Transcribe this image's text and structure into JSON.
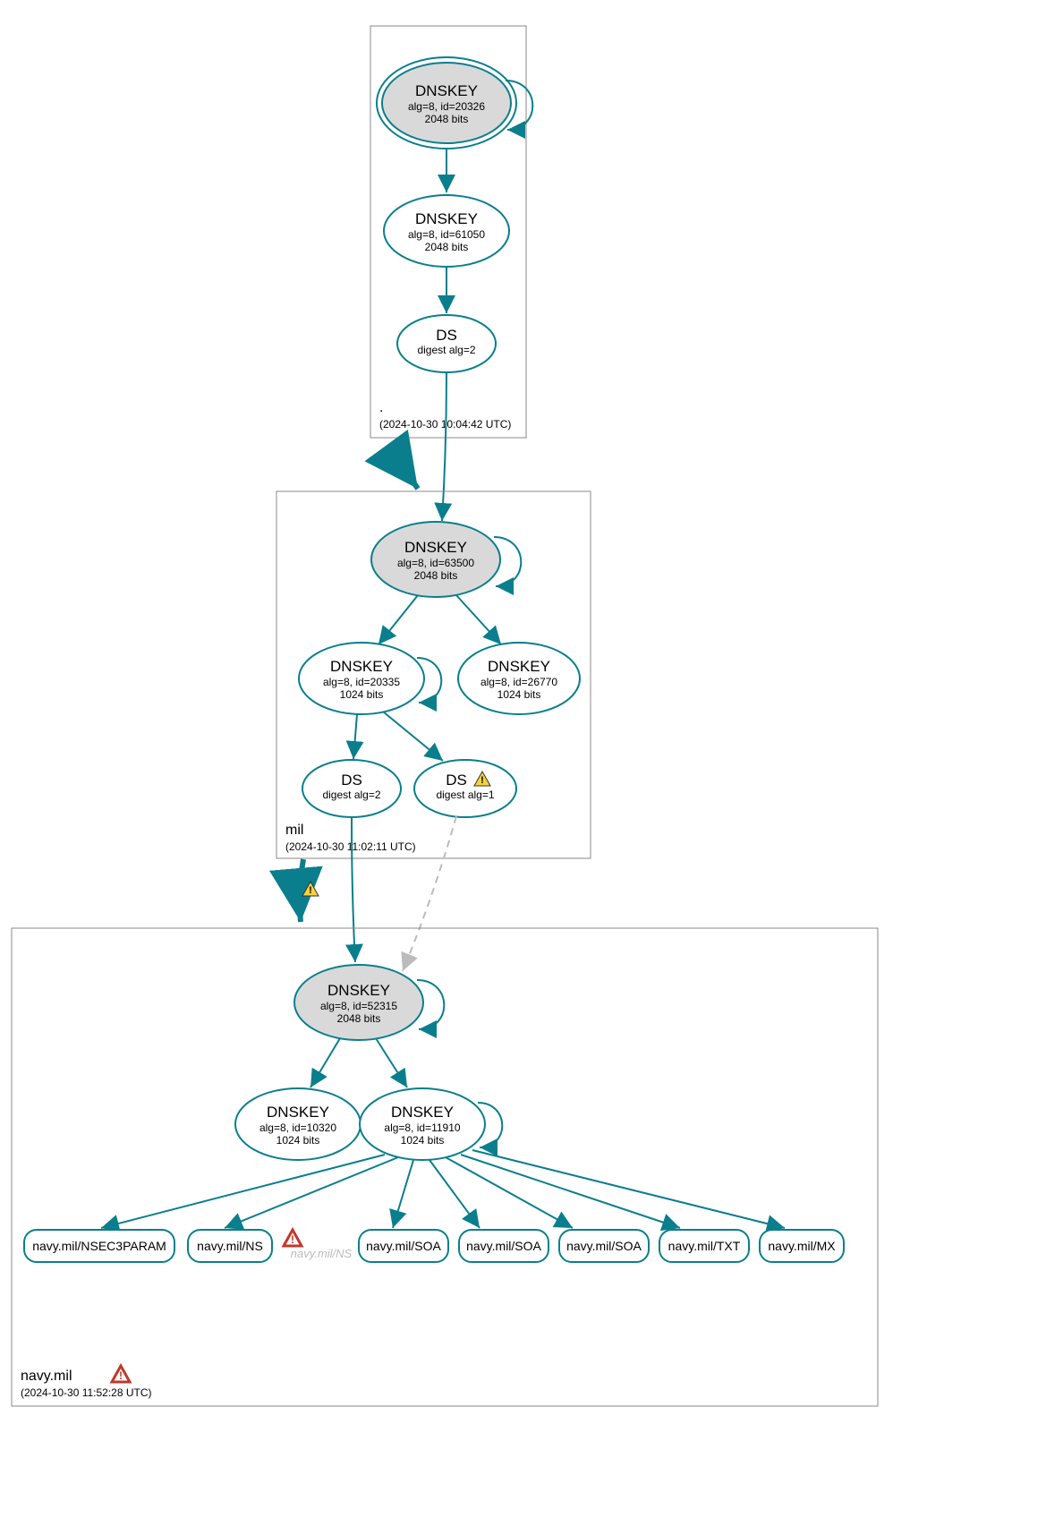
{
  "zones": {
    "root": {
      "label": ".",
      "timestamp": "(2024-10-30 10:04:42 UTC)"
    },
    "mil": {
      "label": "mil",
      "timestamp": "(2024-10-30 11:02:11 UTC)"
    },
    "navy": {
      "label": "navy.mil",
      "timestamp": "(2024-10-30 11:52:28 UTC)"
    }
  },
  "nodes": {
    "root_ksk": {
      "t": "DNSKEY",
      "l1": "alg=8, id=20326",
      "l2": "2048 bits"
    },
    "root_zsk": {
      "t": "DNSKEY",
      "l1": "alg=8, id=61050",
      "l2": "2048 bits"
    },
    "root_ds": {
      "t": "DS",
      "l1": "digest alg=2"
    },
    "mil_ksk": {
      "t": "DNSKEY",
      "l1": "alg=8, id=63500",
      "l2": "2048 bits"
    },
    "mil_zsk1": {
      "t": "DNSKEY",
      "l1": "alg=8, id=20335",
      "l2": "1024 bits"
    },
    "mil_zsk2": {
      "t": "DNSKEY",
      "l1": "alg=8, id=26770",
      "l2": "1024 bits"
    },
    "mil_ds1": {
      "t": "DS",
      "l1": "digest alg=2"
    },
    "mil_ds2": {
      "t": "DS",
      "l1": "digest alg=1"
    },
    "navy_ksk": {
      "t": "DNSKEY",
      "l1": "alg=8, id=52315",
      "l2": "2048 bits"
    },
    "navy_zsk1": {
      "t": "DNSKEY",
      "l1": "alg=8, id=10320",
      "l2": "1024 bits"
    },
    "navy_zsk2": {
      "t": "DNSKEY",
      "l1": "alg=8, id=11910",
      "l2": "1024 bits"
    }
  },
  "rr": {
    "nsec3": "navy.mil/NSEC3PARAM",
    "ns": "navy.mil/NS",
    "ns_err": "navy.mil/NS",
    "soa1": "navy.mil/SOA",
    "soa2": "navy.mil/SOA",
    "soa3": "navy.mil/SOA",
    "txt": "navy.mil/TXT",
    "mx": "navy.mil/MX"
  },
  "colors": {
    "accent": "#0a7e8c",
    "gray": "#d9d9d9"
  }
}
